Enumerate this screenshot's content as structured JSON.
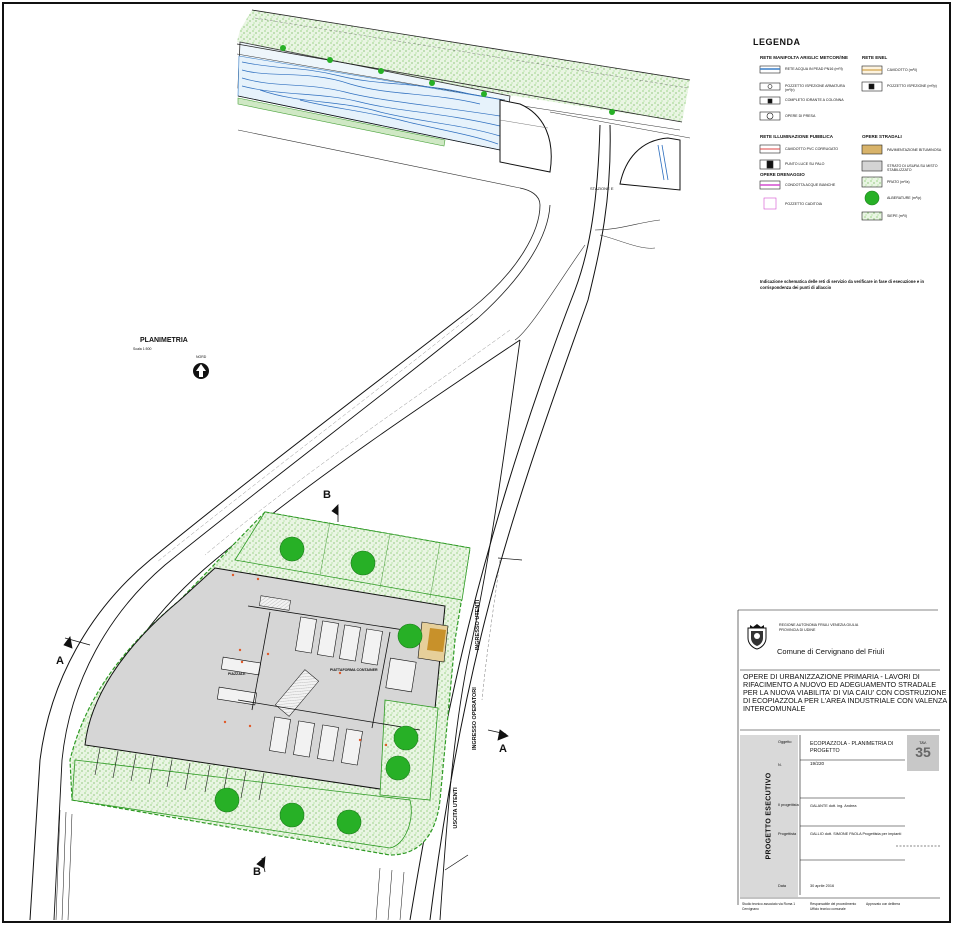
{
  "legend": {
    "title": "LEGENDA",
    "groups": {
      "water": "RETE MANIFOLTA ARIGLIC METCOR/INE",
      "enel": "RETE ENEL",
      "lighting": "RETE ILLUMINAZIONE PUBBLICA",
      "drainage": "OPERE DRENAGGIO",
      "road": "OPERE STRADALI"
    },
    "items": {
      "water_1": "RETE ACQUA IN PEAD PN16 (m²/l)",
      "water_2": "POZZETTO ISPEZIONE ARMATURA (m²/p)",
      "water_3": "COMPLETO IDRANTE A COLONNA",
      "water_4": "OPERE DI PRESA",
      "enel_1": "CAVIDOTTO (m²/l)",
      "enel_2": "POZZETTO ISPEZIONE (m²/p)",
      "light_1": "CAVIDOTTO PVC CORRUGATO",
      "light_2": "PUNTO LUCE SU PALO",
      "drain_1": "CONDOTTA ACQUE BIANCHE",
      "drain_2": "POZZETTO CADITOIA",
      "road_1": "PAVIMENTAZIONE BITUMINOSA",
      "road_2": "STRATO DI USURA SU MISTO STABILIZZATO",
      "road_3": "PRATO (m²/a)",
      "road_4": "ALBERATURE (m²/p)",
      "road_5": "SIEPE (m²/l)"
    },
    "note": "Indicazione schematica delle reti di servizio da verificare in fase di esecuzione e in corrispondenza dei punti di allaccio"
  },
  "plan": {
    "title": "PLANIMETRIA",
    "scale": "Scala 1:500",
    "north": "NORD",
    "station_label": "STAZIONE E",
    "sections": {
      "a": "A",
      "b": "B"
    },
    "access_users_top": "INGRESSO UTENTI",
    "access_operators": "INGRESSO OPERATORI",
    "access_users_bottom": "USCITA UTENTI",
    "building_label_1": "PIATTAFORMA CONTAINER",
    "building_label_2": "PIAZZALE"
  },
  "title_block": {
    "organization": "REGIONE AUTONOMA FRIULI VENEZIA GIULIA  PROVINCIA DI UDINE",
    "municipality": "Comune di Cervignano del Friuli",
    "project_title": "OPERE DI URBANIZZAZIONE PRIMARIA - LAVORI DI RIFACIMENTO A NUOVO ED ADEGUAMENTO STRADALE PER LA NUOVA VIABILITA' DI VIA CAIU' CON COSTRUZIONE DI ECOPIAZZOLA PER L'AREA INDUSTRIALE CON VALENZA INTERCOMUNALE",
    "phase": "PROGETTO ESECUTIVO",
    "label_object": "Oggetto",
    "label_number": "N.",
    "label_designer": "Il progettista",
    "label_collaborator": "Progettista",
    "label_date": "Data",
    "drawing_description": "ECOPIAZZOLA - PLANIMETRIA DI PROGETTO",
    "project_code": "19/220",
    "designer_name": "GALANTE dott. ing. Andrea",
    "collaborator_name": "GALLIO dott. SIMONE PAOLA  Progettista per impianti",
    "date": "30 aprile 2016",
    "sheet_label": "TAV.",
    "sheet_number": "35",
    "footer_1": "Studio tecnico associato  via Roma 1  Cervignano",
    "footer_2": "Responsabile del procedimento  Ufficio tecnico comunale",
    "footer_3": "Approvato con delibera"
  },
  "colors": {
    "lawn": "#d8ecd0",
    "lawn_dot": "#6bbf4e",
    "tree": "#27b026",
    "pavement": "#d4d4d4",
    "water": "#9ec9ee",
    "tb_band": "#d9d9d9",
    "magenta": "#d44dd0",
    "orange_access": "#c8912a",
    "sand": "#e6cf9a"
  }
}
